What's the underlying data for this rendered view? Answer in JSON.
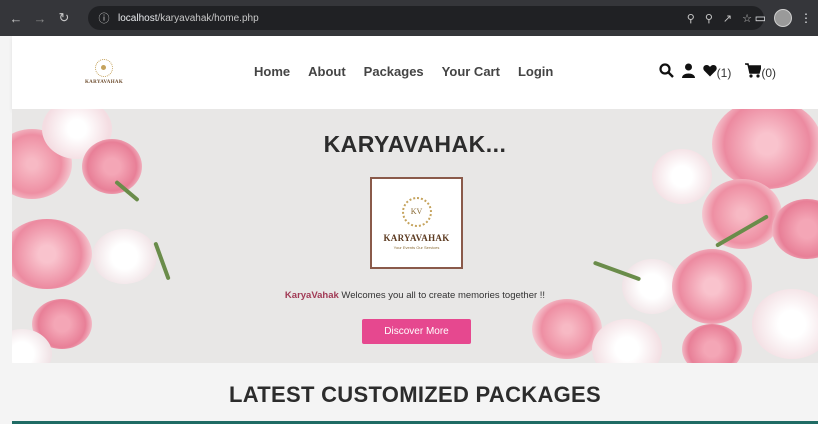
{
  "browser": {
    "url_host": "localhost",
    "url_path": "/karyavahak/home.php"
  },
  "header": {
    "logo_text": "KARYAVAHAK",
    "nav": [
      {
        "label": "Home"
      },
      {
        "label": "About"
      },
      {
        "label": "Packages"
      },
      {
        "label": "Your Cart"
      },
      {
        "label": "Login"
      }
    ],
    "icons": [
      "search-icon",
      "user-icon",
      "heart-icon",
      "cart-icon"
    ],
    "wishlist_count": "(1)",
    "cart_count": "(0)"
  },
  "hero": {
    "title": "KARYAVAHAK...",
    "logo_initials": "KV",
    "logo_name": "KARYAVAHAK",
    "logo_tagline": "Your Events Our Services",
    "welcome_brand": "KaryaVahak",
    "welcome_text": " Welcomes you all to create memories together !!",
    "button_label": "Discover More"
  },
  "section": {
    "title": "LATEST CUSTOMIZED PACKAGES"
  },
  "colors": {
    "accent": "#e6488f",
    "brand_text": "#a13a55",
    "chrome": "#35363a"
  }
}
